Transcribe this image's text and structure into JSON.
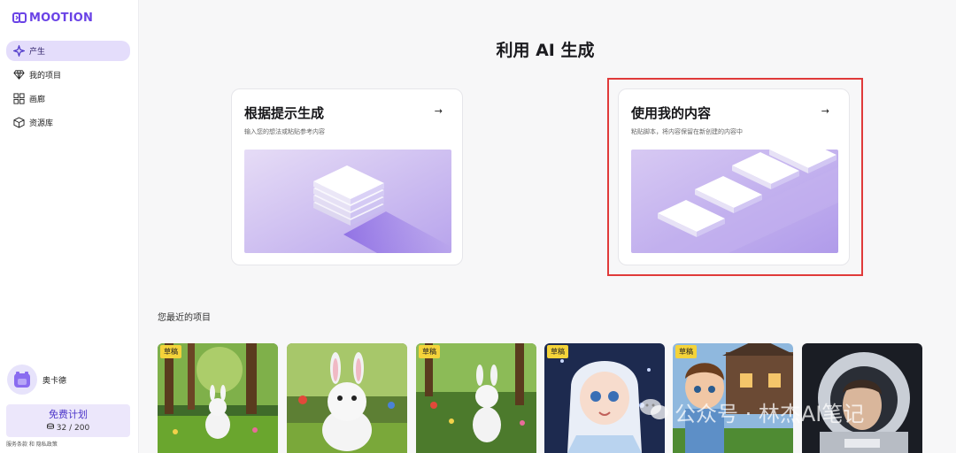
{
  "app": {
    "logo_text": "MOOTION"
  },
  "sidebar": {
    "items": [
      {
        "label": "产生",
        "icon": "sparkle-icon",
        "active": true
      },
      {
        "label": "我的项目",
        "icon": "diamond-icon",
        "active": false
      },
      {
        "label": "画廊",
        "icon": "grid-icon",
        "active": false
      },
      {
        "label": "资源库",
        "icon": "cube-icon",
        "active": false
      }
    ],
    "user_name": "奥卡德",
    "plan_name": "免费计划",
    "credits": "32 / 200",
    "footer_links": "服务条款 和 隐私政策"
  },
  "main": {
    "title": "利用 AI 生成",
    "cards": [
      {
        "title": "根据提示生成",
        "description": "输入您的想法或粘贴参考内容",
        "arrow": "→"
      },
      {
        "title": "使用我的内容",
        "description": "粘贴脚本，将内容保留在新创建的内容中",
        "arrow": "→"
      }
    ],
    "recent_title": "您最近的项目",
    "projects": [
      {
        "badge": "草稿"
      },
      {
        "badge": ""
      },
      {
        "badge": "草稿"
      },
      {
        "badge": "草稿"
      },
      {
        "badge": "草稿"
      },
      {
        "badge": ""
      }
    ]
  },
  "watermark": "公众号 · 林杰AI笔记",
  "colors": {
    "accent": "#6a43e6",
    "active_nav_bg": "#e4ddfb",
    "draft_badge": "#f4d33a",
    "highlight_border": "#e03a3a"
  }
}
